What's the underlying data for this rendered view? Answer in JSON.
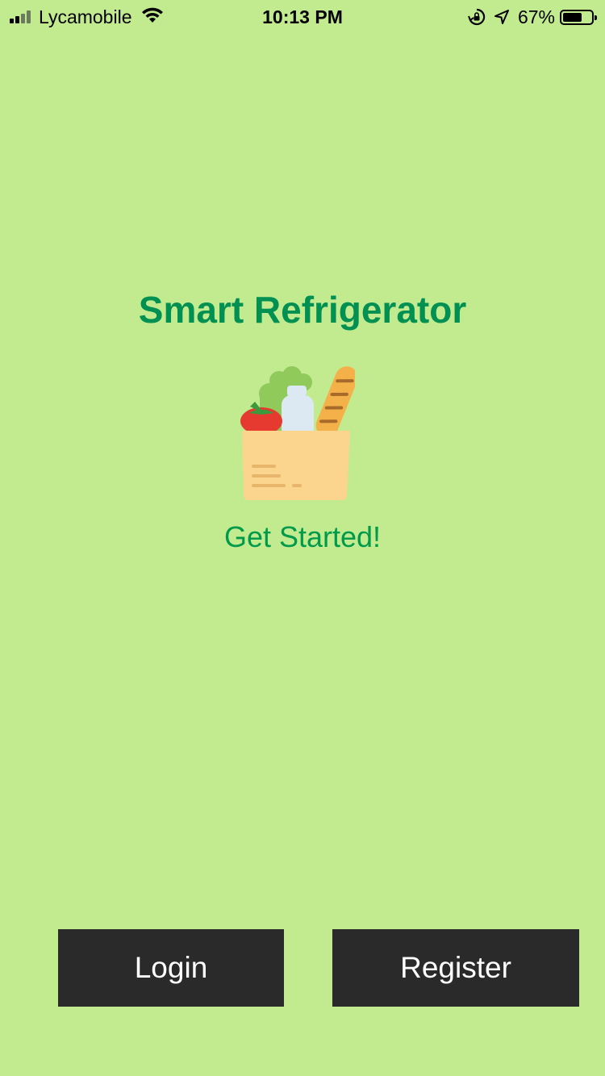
{
  "status_bar": {
    "carrier": "Lycamobile",
    "time": "10:13 PM",
    "battery_percent": "67%",
    "battery_level": 0.67,
    "signal_bars_filled": 2,
    "signal_bars_total": 4,
    "icons": [
      "signal-icon",
      "wifi-icon",
      "orientation-lock-icon",
      "location-arrow-icon",
      "battery-icon"
    ]
  },
  "main": {
    "title": "Smart Refrigerator",
    "subtitle": "Get Started!",
    "illustration": "grocery-bag-icon"
  },
  "buttons": {
    "login_label": "Login",
    "register_label": "Register"
  },
  "colors": {
    "background": "#c2eb90",
    "title": "#009051",
    "subtitle": "#009a4a",
    "button_bg": "#2a2a2a",
    "button_text": "#ffffff"
  }
}
